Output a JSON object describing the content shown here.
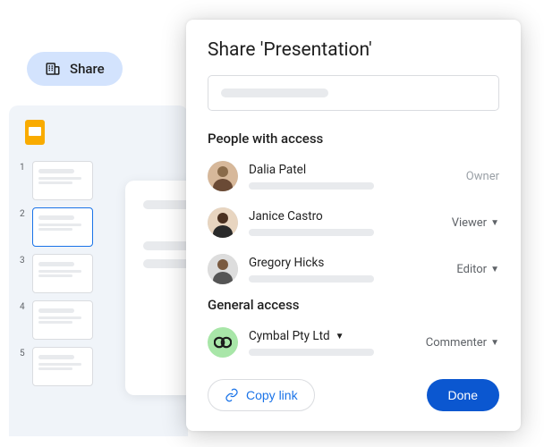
{
  "share_chip": {
    "label": "Share"
  },
  "dialog": {
    "title": "Share 'Presentation'",
    "sections": {
      "people_header": "People with access",
      "general_header": "General access"
    },
    "people": [
      {
        "name": "Dalia Patel",
        "role": "Owner",
        "role_interactive": false
      },
      {
        "name": "Janice Castro",
        "role": "Viewer",
        "role_interactive": true
      },
      {
        "name": "Gregory Hicks",
        "role": "Editor",
        "role_interactive": true
      }
    ],
    "general": {
      "org_name": "Cymbal Pty Ltd",
      "role": "Commenter"
    },
    "copy_link": "Copy link",
    "done": "Done"
  }
}
